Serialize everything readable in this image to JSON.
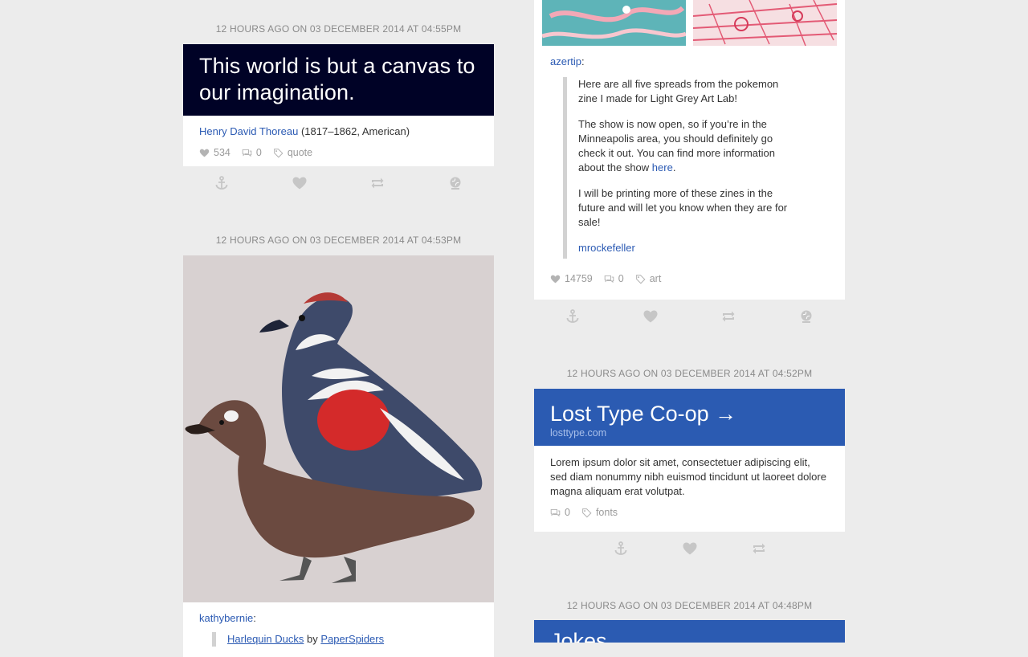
{
  "left": {
    "post1": {
      "timestamp": "12 HOURS AGO ON 03 DECEMBER 2014 AT 04:55PM",
      "quote": "This world is but a canvas to our imagination.",
      "author_link": "Henry David Thoreau",
      "author_info": " (1817–1862, American)",
      "likes": "534",
      "comments": "0",
      "tag": "quote"
    },
    "post2": {
      "timestamp": "12 HOURS AGO ON 03 DECEMBER 2014 AT 04:53PM",
      "image_alt": "Harlequin Ducks illustration",
      "reblogger": "kathybernie",
      "colon": ":",
      "quote_line_start": "Harlequin Ducks",
      "by": " by ",
      "quote_artist": "PaperSpiders"
    }
  },
  "right": {
    "post1": {
      "reblogger": "azertip",
      "colon": ":",
      "p1": "Here are all five spreads from the pokemon zine I made for Light Grey Art Lab!",
      "p2_start": "The show is now open, so if you’re in the Minneapolis area, you should definitely go check it out. You can find more information about the show ",
      "p2_link": "here",
      "p2_end": ".",
      "p3": "I will be printing more of these zines in the future and will let you know when they are for sale!",
      "source_user": "mrockefeller",
      "likes": "14759",
      "comments": "0",
      "tag": "art"
    },
    "post2": {
      "timestamp": "12 HOURS AGO ON 03 DECEMBER 2014 AT 04:52PM",
      "title": "Lost Type Co-op →",
      "url": "losttype.com",
      "body": "Lorem ipsum dolor sit amet, consectetuer adipiscing elit, sed diam nonummy nibh euismod tincidunt ut laoreet dolore magna aliquam erat volutpat.",
      "comments": "0",
      "tag": "fonts"
    },
    "post3": {
      "timestamp": "12 HOURS AGO ON 03 DECEMBER 2014 AT 04:48PM",
      "title": "Jokes"
    }
  },
  "icons": {
    "heart": "heart-icon",
    "comment": "comment-icon",
    "tag": "tag-icon",
    "anchor": "anchor-icon",
    "like": "like-icon",
    "reblog": "reblog-icon",
    "globe": "globe-icon"
  },
  "colors": {
    "quote_bg": "#000226",
    "link_bg": "#2b5bb2",
    "link_text": "#2b5ab3",
    "background": "#ececec"
  }
}
